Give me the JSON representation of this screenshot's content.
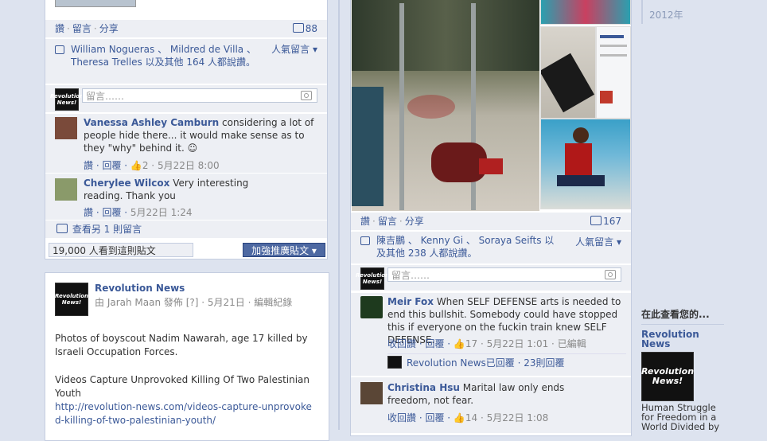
{
  "left_post": {
    "actions": {
      "like": "讚",
      "comment": "留言",
      "share": "分享"
    },
    "comment_count": "88",
    "likes": {
      "names": "William Nogueras 、 Mildred de Villa 、 Theresa Trelles 以及其他 164 人都說讚。",
      "sort": "人氣留言"
    },
    "comment_placeholder": "留言……",
    "comments": [
      {
        "name": "Vanessa Ashley Camburn",
        "text": "considering a lot of people hide there... it would make sense as to they \"why\" behind it. ☺",
        "actions": "讚 · 回覆 · ",
        "likes": "2",
        "time": "5月22日 8:00"
      },
      {
        "name": "Cherylee Wilcox",
        "text": "Very interesting reading. Thank you",
        "actions": "讚 · 回覆 · ",
        "time": "5月22日 1:24"
      }
    ],
    "more_comments": "查看另 1 則留言",
    "reach": "19,000 人看到這則貼文",
    "boost_button": "加強推廣貼文"
  },
  "news_post": {
    "page_name": "Revolution News",
    "avatar_text": "Revolution News!",
    "byline": "由 Jarah Maan 發佈 [?] · 5月21日 · 編輯紀錄",
    "body1": "Photos of boyscout Nadim Nawarah, age 17 killed by Israeli Occupation Forces.",
    "body2": "Videos Capture Unprovoked Killing Of Two Palestinian Youth",
    "link": "http://revolution-news.com/videos-capture-unprovoked-killing-of-two-palestinian-youth/"
  },
  "right_post": {
    "actions": {
      "like": "讚",
      "comment": "留言",
      "share": "分享"
    },
    "comment_count": "167",
    "likes": {
      "names": "陳吉鵬 、 Kenny Gi 、 Soraya Seifts 以及其他 238 人都說讚。",
      "sort": "人氣留言"
    },
    "comment_placeholder": "留言……",
    "comments": [
      {
        "name": "Meir Fox",
        "text": "When SELF DEFENSE arts is needed to end this bullshit. Somebody could have stopped this if everyone on the fuckin train knew SELF DEFENSE.",
        "actions": "收回讚 · 回覆 · ",
        "likes": "17",
        "time": "5月22日 1:01 · 已編輯"
      },
      {
        "name": "Christina Hsu",
        "text": "Marital law only ends freedom, not fear.",
        "actions": "收回讚 · 回覆 · ",
        "likes": "14",
        "time": "5月22日 1:08"
      }
    ],
    "reply_summary": "Revolution News已回覆 · 23則回覆"
  },
  "timeline": {
    "year": "2012年"
  },
  "sidebar": {
    "heading": "在此查看您的...",
    "page_name": "Revolution News",
    "caption": "Human Struggle for Freedom in a World Divided by"
  }
}
